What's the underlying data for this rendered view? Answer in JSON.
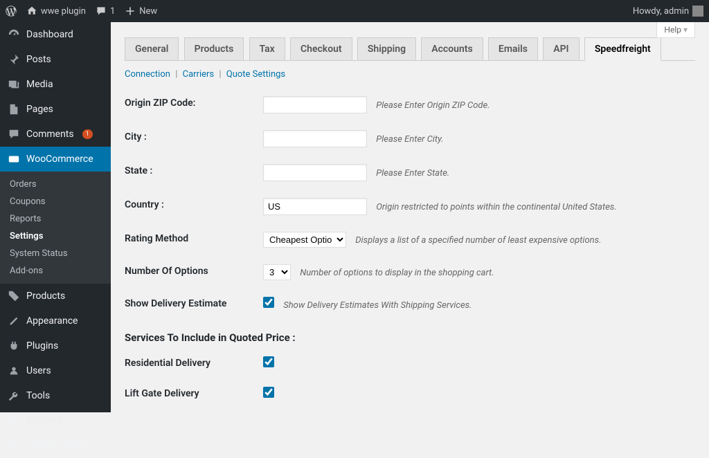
{
  "adminbar": {
    "site_name": "wwe plugin",
    "comment_count": "1",
    "new_label": "New",
    "howdy": "Howdy, admin"
  },
  "help_label": "Help",
  "sidebar": {
    "items": [
      {
        "label": "Dashboard"
      },
      {
        "label": "Posts"
      },
      {
        "label": "Media"
      },
      {
        "label": "Pages"
      },
      {
        "label": "Comments",
        "badge": "1"
      },
      {
        "label": "WooCommerce"
      },
      {
        "label": "Products"
      },
      {
        "label": "Appearance"
      },
      {
        "label": "Plugins"
      },
      {
        "label": "Users"
      },
      {
        "label": "Tools"
      },
      {
        "label": "Settings"
      }
    ],
    "woo_submenu": [
      {
        "label": "Orders"
      },
      {
        "label": "Coupons"
      },
      {
        "label": "Reports"
      },
      {
        "label": "Settings"
      },
      {
        "label": "System Status"
      },
      {
        "label": "Add-ons"
      }
    ],
    "collapse": "Collapse menu"
  },
  "tabs": [
    {
      "label": "General"
    },
    {
      "label": "Products"
    },
    {
      "label": "Tax"
    },
    {
      "label": "Checkout"
    },
    {
      "label": "Shipping"
    },
    {
      "label": "Accounts"
    },
    {
      "label": "Emails"
    },
    {
      "label": "API"
    },
    {
      "label": "Speedfreight"
    }
  ],
  "subtabs": {
    "connection": "Connection",
    "carriers": "Carriers",
    "quote": "Quote Settings"
  },
  "form": {
    "origin_zip": {
      "label": "Origin ZIP Code:",
      "value": "",
      "hint": "Please Enter Origin ZIP Code."
    },
    "city": {
      "label": "City :",
      "value": "",
      "hint": "Please Enter City."
    },
    "state": {
      "label": "State :",
      "value": "",
      "hint": "Please Enter State."
    },
    "country": {
      "label": "Country :",
      "value": "US",
      "hint": "Origin restricted to points within the continental United States."
    },
    "rating_method": {
      "label": "Rating Method",
      "value": "Cheapest Options",
      "hint": "Displays a list of a specified number of least expensive options."
    },
    "num_options": {
      "label": "Number Of Options",
      "value": "3",
      "hint": "Number of options to display in the shopping cart."
    },
    "show_delivery": {
      "label": "Show Delivery Estimate",
      "hint": "Show Delivery Estimates With Shipping Services."
    },
    "section_services": "Services To Include in Quoted Price :",
    "residential": {
      "label": "Residential Delivery"
    },
    "liftgate": {
      "label": "Lift Gate Delivery"
    }
  }
}
